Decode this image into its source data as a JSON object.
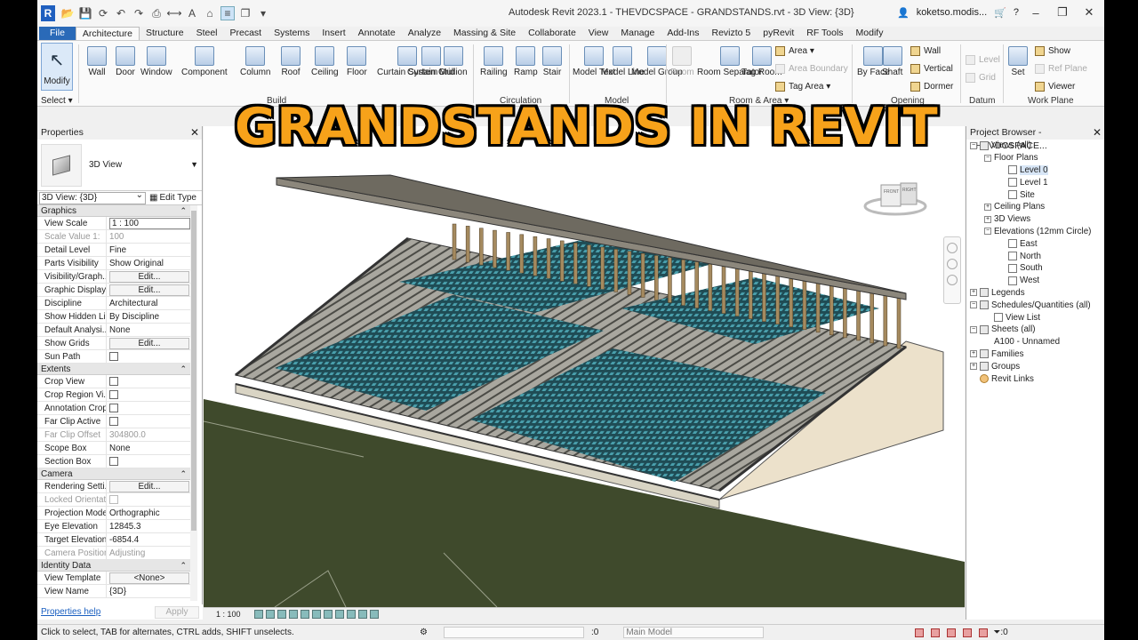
{
  "window": {
    "app_logo": "R",
    "title": "Autodesk Revit 2023.1 - THEVDCSPACE - GRANDSTANDS.rvt - 3D View: {3D}",
    "user": "koketso.modis...",
    "help": "?",
    "minimize": "–",
    "restore": "❐",
    "close": "✕"
  },
  "overlay_title": "GRANDSTANDS IN REVIT",
  "ribbon_tabs": [
    "File",
    "Architecture",
    "Structure",
    "Steel",
    "Precast",
    "Systems",
    "Insert",
    "Annotate",
    "Analyze",
    "Massing & Site",
    "Collaborate",
    "View",
    "Manage",
    "Add-Ins",
    "Revizto 5",
    "pyRevit",
    "RF Tools",
    "Modify"
  ],
  "active_tab": "Architecture",
  "ribbon": {
    "modify": "Modify",
    "select_label": "Select ▾",
    "build": [
      "Wall",
      "Door",
      "Window",
      "Component",
      "Column",
      "Roof",
      "Ceiling",
      "Floor",
      "Curtain System",
      "Curtain Grid",
      "Mullion"
    ],
    "circulation": [
      "Railing",
      "Ramp",
      "Stair"
    ],
    "model": [
      "Model Text",
      "Model Line",
      "Model Group"
    ],
    "room": [
      "Room",
      "Room Separator",
      "Tag Room"
    ],
    "room_small": [
      "Area ▾",
      "Area Boundary",
      "Tag Area ▾"
    ],
    "opening": [
      "By Face",
      "Shaft"
    ],
    "opening_small": [
      "Wall",
      "Vertical",
      "Dormer"
    ],
    "datum": [
      "Level",
      "Grid"
    ],
    "workplane": [
      "Set"
    ],
    "workplane_small": [
      "Show",
      "Ref Plane",
      "Viewer"
    ],
    "panels": {
      "select": "Select",
      "build": "Build",
      "circulation": "Circulation",
      "model": "Model",
      "room": "Room & Area ▾",
      "opening": "Opening",
      "datum": "Datum",
      "workplane": "Work Plane"
    }
  },
  "properties": {
    "header": "Properties",
    "type_name": "3D View",
    "selector": "3D View: {3D}",
    "edit_type": "Edit Type",
    "groups": [
      {
        "name": "Graphics",
        "rows": [
          {
            "k": "View Scale",
            "v": "1 : 100",
            "kind": "box"
          },
          {
            "k": "Scale Value    1:",
            "v": "100",
            "kind": "text",
            "dis": true
          },
          {
            "k": "Detail Level",
            "v": "Fine",
            "kind": "text"
          },
          {
            "k": "Parts Visibility",
            "v": "Show Original",
            "kind": "text"
          },
          {
            "k": "Visibility/Graph...",
            "v": "Edit...",
            "kind": "btn"
          },
          {
            "k": "Graphic Display...",
            "v": "Edit...",
            "kind": "btn"
          },
          {
            "k": "Discipline",
            "v": "Architectural",
            "kind": "text"
          },
          {
            "k": "Show Hidden Li...",
            "v": "By Discipline",
            "kind": "text"
          },
          {
            "k": "Default Analysi...",
            "v": "None",
            "kind": "text"
          },
          {
            "k": "Show Grids",
            "v": "Edit...",
            "kind": "btn"
          },
          {
            "k": "Sun Path",
            "v": "",
            "kind": "cb"
          }
        ]
      },
      {
        "name": "Extents",
        "rows": [
          {
            "k": "Crop View",
            "v": "",
            "kind": "cb"
          },
          {
            "k": "Crop Region Vi...",
            "v": "",
            "kind": "cb"
          },
          {
            "k": "Annotation Crop",
            "v": "",
            "kind": "cb"
          },
          {
            "k": "Far Clip Active",
            "v": "",
            "kind": "cb"
          },
          {
            "k": "Far Clip Offset",
            "v": "304800.0",
            "kind": "text",
            "dis": true
          },
          {
            "k": "Scope Box",
            "v": "None",
            "kind": "text"
          },
          {
            "k": "Section Box",
            "v": "",
            "kind": "cb"
          }
        ]
      },
      {
        "name": "Camera",
        "rows": [
          {
            "k": "Rendering Setti...",
            "v": "Edit...",
            "kind": "btn"
          },
          {
            "k": "Locked Orientat...",
            "v": "",
            "kind": "cb",
            "dis": true
          },
          {
            "k": "Projection Mode",
            "v": "Orthographic",
            "kind": "text"
          },
          {
            "k": "Eye Elevation",
            "v": "12845.3",
            "kind": "text"
          },
          {
            "k": "Target Elevation",
            "v": "-6854.4",
            "kind": "text"
          },
          {
            "k": "Camera Position",
            "v": "Adjusting",
            "kind": "text",
            "dis": true
          }
        ]
      },
      {
        "name": "Identity Data",
        "rows": [
          {
            "k": "View Template",
            "v": "<None>",
            "kind": "btn"
          },
          {
            "k": "View Name",
            "v": "{3D}",
            "kind": "text"
          }
        ]
      }
    ],
    "help_link": "Properties help",
    "apply": "Apply"
  },
  "viewcube": {
    "front": "FRONT",
    "right": "RIGHT"
  },
  "view_status": {
    "scale": "1 : 100"
  },
  "project_browser": {
    "header": "Project Browser - THEVDCSPACE...",
    "items": [
      {
        "label": "Views (all)",
        "indent": 0,
        "exp": "−",
        "icon": "views"
      },
      {
        "label": "Floor Plans",
        "indent": 1,
        "exp": "−",
        "icon": ""
      },
      {
        "label": "Level 0",
        "indent": 2,
        "exp": "",
        "icon": "view",
        "sel": true
      },
      {
        "label": "Level 1",
        "indent": 2,
        "exp": "",
        "icon": "view"
      },
      {
        "label": "Site",
        "indent": 2,
        "exp": "",
        "icon": "view"
      },
      {
        "label": "Ceiling Plans",
        "indent": 1,
        "exp": "+",
        "icon": ""
      },
      {
        "label": "3D Views",
        "indent": 1,
        "exp": "+",
        "icon": ""
      },
      {
        "label": "Elevations (12mm Circle)",
        "indent": 1,
        "exp": "−",
        "icon": ""
      },
      {
        "label": "East",
        "indent": 2,
        "exp": "",
        "icon": "view"
      },
      {
        "label": "North",
        "indent": 2,
        "exp": "",
        "icon": "view"
      },
      {
        "label": "South",
        "indent": 2,
        "exp": "",
        "icon": "view"
      },
      {
        "label": "West",
        "indent": 2,
        "exp": "",
        "icon": "view"
      },
      {
        "label": "Legends",
        "indent": 0,
        "exp": "+",
        "icon": "folder"
      },
      {
        "label": "Schedules/Quantities (all)",
        "indent": 0,
        "exp": "−",
        "icon": "folder"
      },
      {
        "label": "View List",
        "indent": 1,
        "exp": "",
        "icon": "view"
      },
      {
        "label": "Sheets (all)",
        "indent": 0,
        "exp": "−",
        "icon": "folder"
      },
      {
        "label": "A100 - Unnamed",
        "indent": 1,
        "exp": "",
        "icon": ""
      },
      {
        "label": "Families",
        "indent": 0,
        "exp": "+",
        "icon": "folder"
      },
      {
        "label": "Groups",
        "indent": 0,
        "exp": "+",
        "icon": "folder"
      },
      {
        "label": "Revit Links",
        "indent": 0,
        "exp": "",
        "icon": "link"
      }
    ]
  },
  "statusbar": {
    "message": "Click to select, TAB for alternates, CTRL adds, SHIFT unselects.",
    "count_a": ":0",
    "model": "Main Model",
    "filter_count": ":0"
  },
  "colors": {
    "banner_fill": "#f7a21a",
    "file_tab": "#2a6ab8",
    "field": "#3f4a2c",
    "seats": "#2f6f7a",
    "roof": "#6e6a60",
    "concrete": "#ece1cb"
  }
}
